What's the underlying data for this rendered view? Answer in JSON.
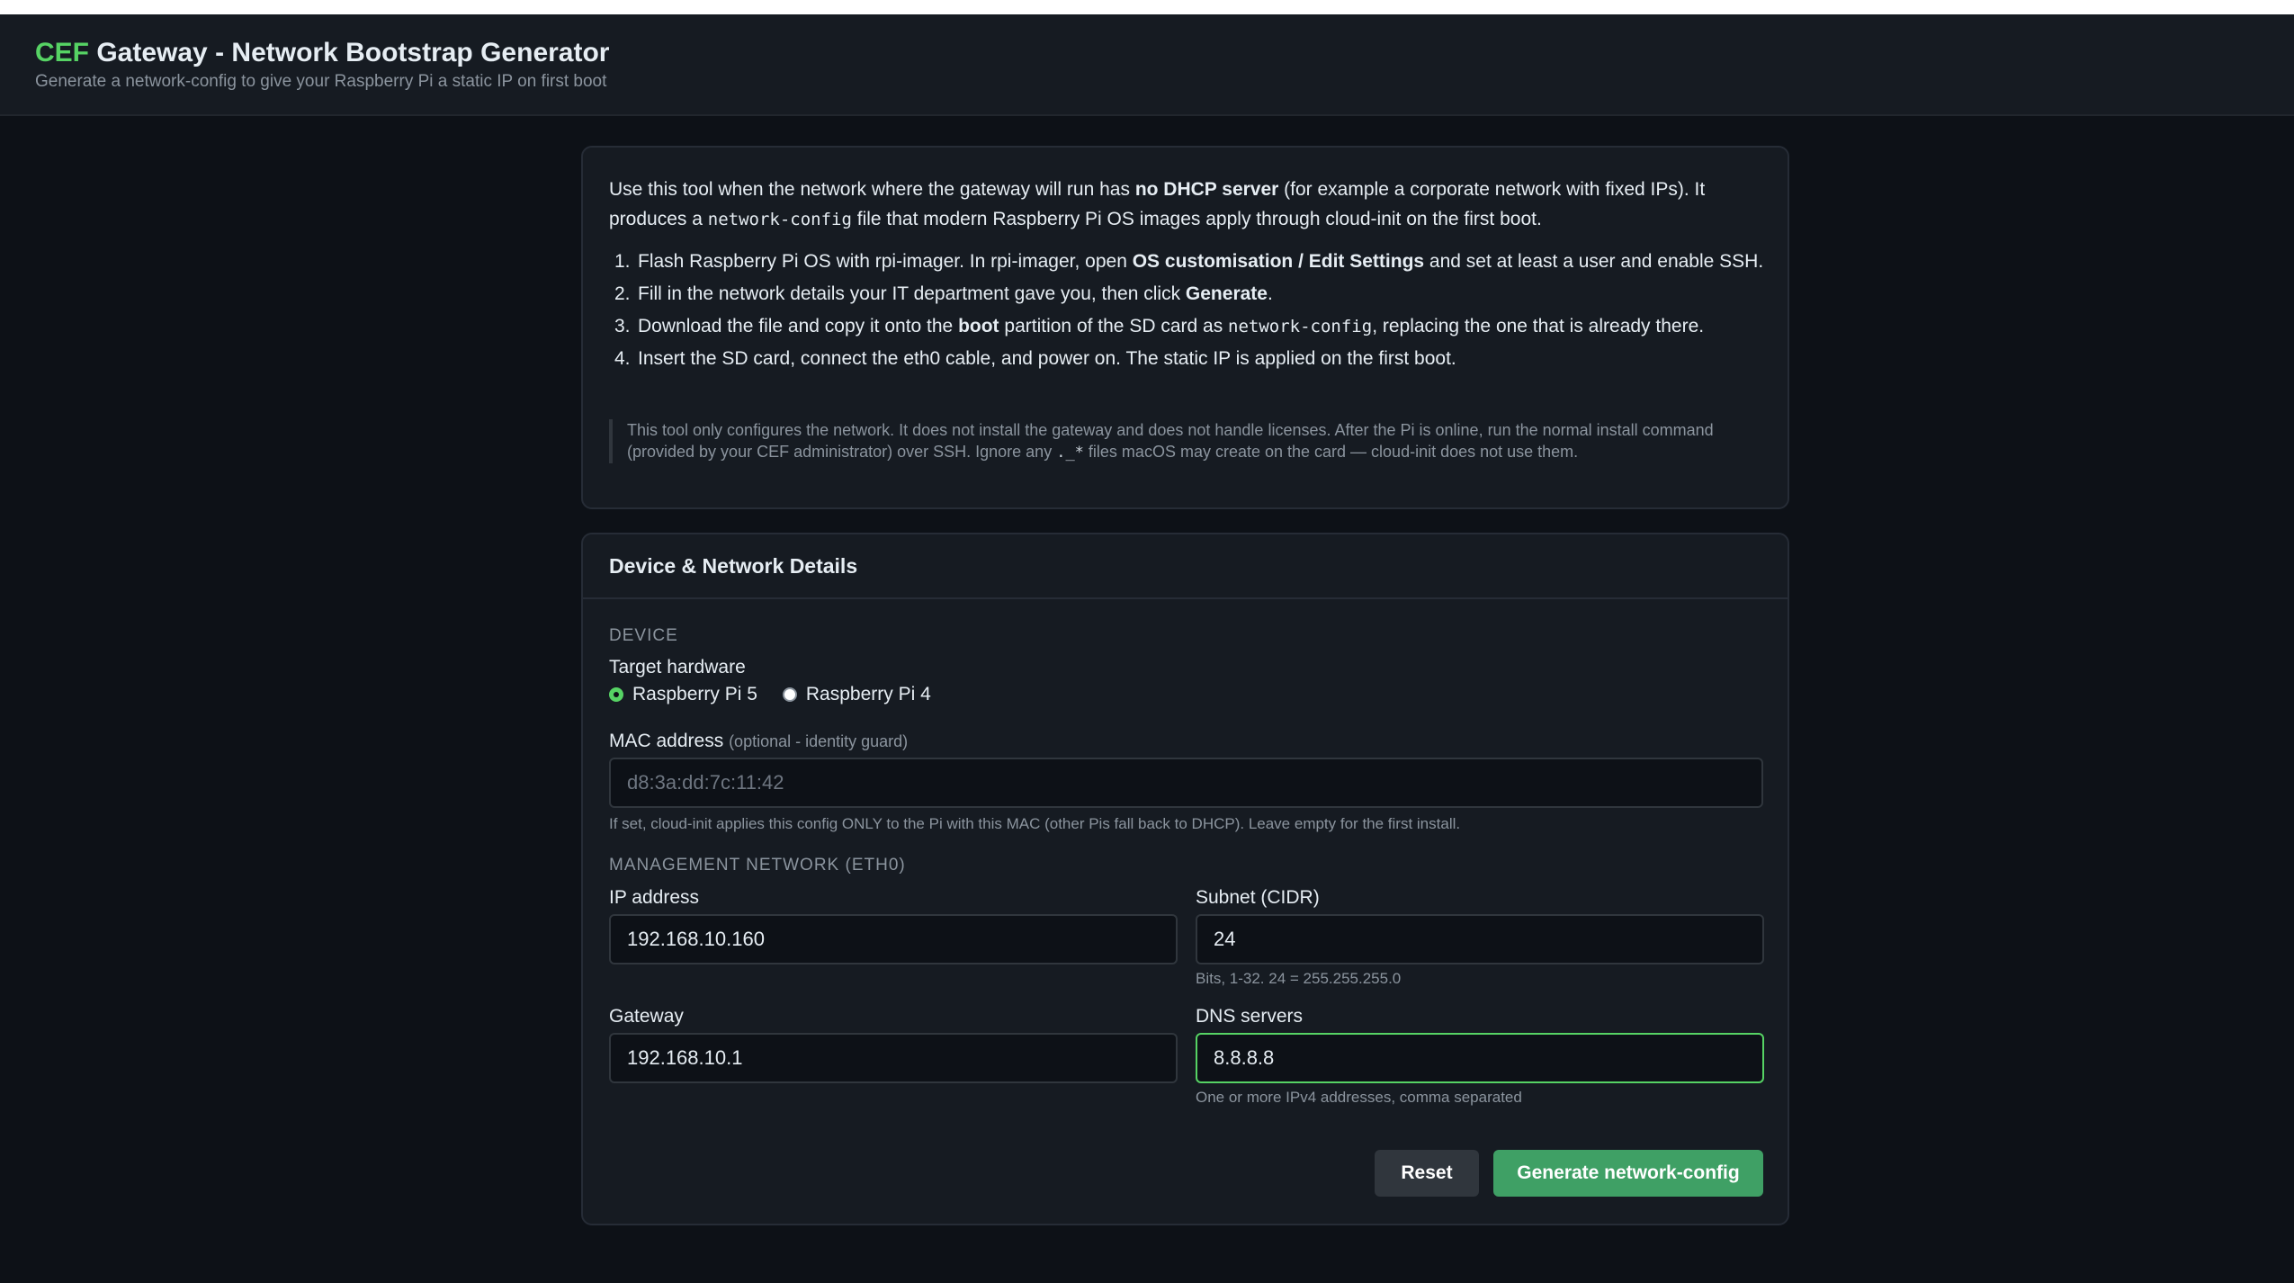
{
  "header": {
    "brand": "CEF",
    "title_rest": "Gateway - Network Bootstrap Generator",
    "subtitle": "Generate a network-config to give your Raspberry Pi a static IP on first boot"
  },
  "info": {
    "intro_1": "Use this tool when the network where the gateway will run has ",
    "intro_bold": "no DHCP server",
    "intro_2": " (for example a corporate network with fixed IPs). It produces a ",
    "intro_code": "network-config",
    "intro_3": " file that modern Raspberry Pi OS images apply through cloud-init on the first boot.",
    "steps": [
      {
        "num": "1.",
        "a": "Flash Raspberry Pi OS with rpi-imager. In rpi-imager, open ",
        "b": "OS customisation / Edit Settings",
        "c": " and set at least a user and enable SSH."
      },
      {
        "num": "2.",
        "a": "Fill in the network details your IT department gave you, then click ",
        "b": "Generate",
        "c": "."
      },
      {
        "num": "3.",
        "a": "Download the file and copy it onto the ",
        "b": "boot",
        "c": " partition of the SD card as ",
        "code": "network-config",
        "d": ", replacing the one that is already there."
      },
      {
        "num": "4.",
        "a": "Insert the SD card, connect the eth0 cable, and power on. The static IP is applied on the first boot."
      }
    ],
    "note_1": "This tool only configures the network. It does not install the gateway and does not handle licenses. After the Pi is online, run the normal install command (provided by your CEF administrator) over SSH. Ignore any ",
    "note_code": "._*",
    "note_2": " files macOS may create on the card — cloud-init does not use them."
  },
  "form": {
    "title": "Device & Network Details",
    "device_section": "DEVICE",
    "hardware_label": "Target hardware",
    "hardware_options": [
      "Raspberry Pi 5",
      "Raspberry Pi 4"
    ],
    "hardware_selected": "Raspberry Pi 5",
    "mac_label": "MAC address",
    "mac_optional": "(optional - identity guard)",
    "mac_placeholder": "d8:3a:dd:7c:11:42",
    "mac_value": "",
    "mac_hint": "If set, cloud-init applies this config ONLY to the Pi with this MAC (other Pis fall back to DHCP). Leave empty for the first install.",
    "mgmt_section": "MANAGEMENT NETWORK (ETH0)",
    "ip_label": "IP address",
    "ip_value": "192.168.10.160",
    "subnet_label": "Subnet (CIDR)",
    "subnet_value": "24",
    "subnet_hint": "Bits, 1-32. 24 = 255.255.255.0",
    "gateway_label": "Gateway",
    "gateway_value": "192.168.10.1",
    "dns_label": "DNS servers",
    "dns_value": "8.8.8.8",
    "dns_hint": "One or more IPv4 addresses, comma separated",
    "reset_label": "Reset",
    "generate_label": "Generate network-config"
  },
  "colors": {
    "background": "#0d1117",
    "panel": "#161b22",
    "accent": "#56d364",
    "button_primary": "#3fa065"
  }
}
